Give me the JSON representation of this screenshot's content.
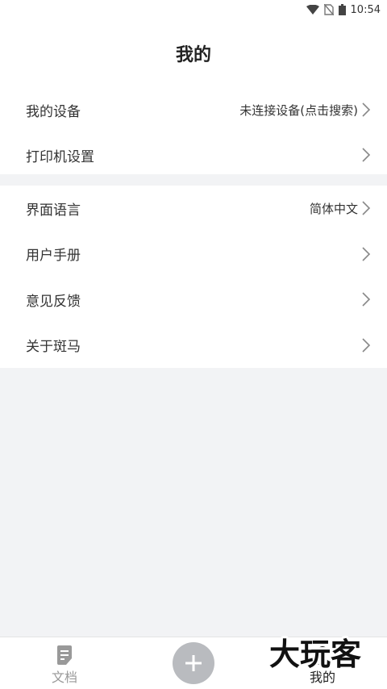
{
  "status_bar": {
    "time": "10:54"
  },
  "header": {
    "title": "我的"
  },
  "group1": [
    {
      "label": "我的设备",
      "value": "未连接设备(点击搜索)"
    },
    {
      "label": "打印机设置",
      "value": ""
    }
  ],
  "group2": [
    {
      "label": "界面语言",
      "value": "简体中文"
    },
    {
      "label": "用户手册",
      "value": ""
    },
    {
      "label": "意见反馈",
      "value": ""
    },
    {
      "label": "关于斑马",
      "value": ""
    }
  ],
  "bottom_nav": {
    "docs_label": "文档",
    "add_icon": "plus-icon",
    "mine_label": "我的"
  },
  "watermark": {
    "text": "大玩客"
  },
  "colors": {
    "background": "#f2f3f5",
    "card": "#ffffff",
    "text": "#333333",
    "muted": "#999999",
    "add_button": "#b9bbbf"
  }
}
